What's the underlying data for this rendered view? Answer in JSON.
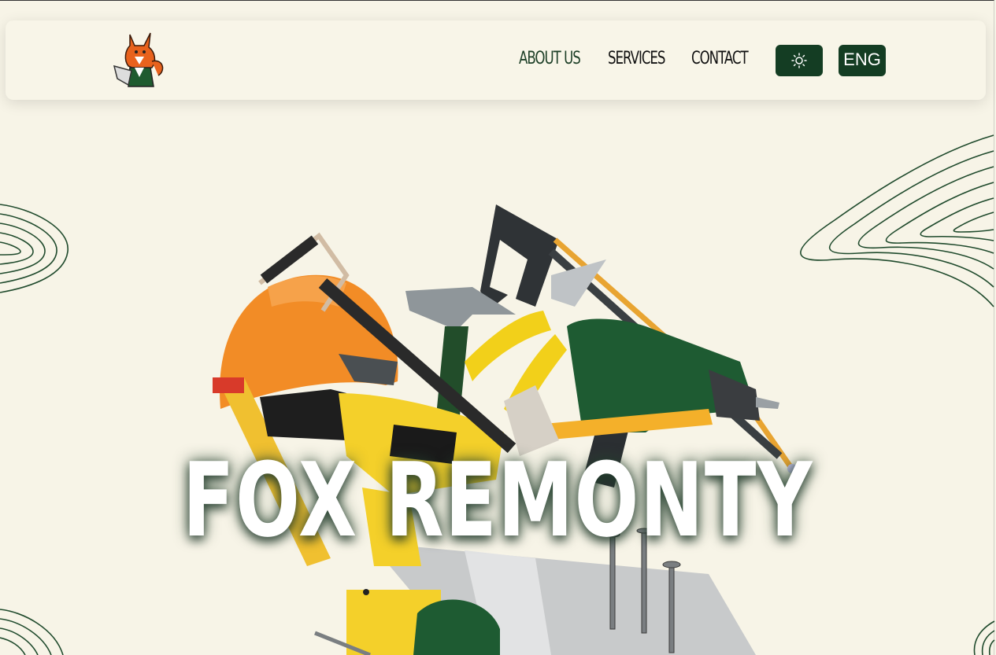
{
  "nav": {
    "links": [
      {
        "label": "ABOUT US",
        "active": true
      },
      {
        "label": "SERVICES",
        "active": false
      },
      {
        "label": "CONTACT",
        "active": false
      }
    ],
    "theme_toggle_icon": "sun-icon",
    "language_label": "ENG"
  },
  "hero": {
    "title": "FOX REMONTY",
    "illustration": "construction-tools-illustration"
  },
  "colors": {
    "background": "#f7f4e7",
    "accent_green": "#143d23",
    "contour_lines": "#1f4a2c"
  }
}
